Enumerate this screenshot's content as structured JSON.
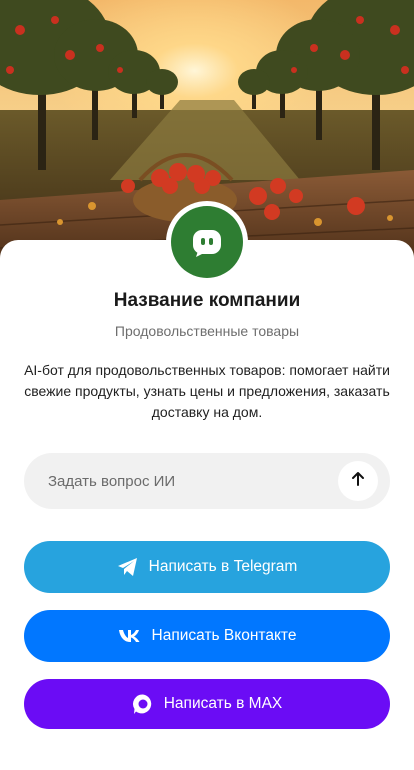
{
  "company": {
    "name": "Название компании",
    "category": "Продовольственные товары",
    "description": "AI-бот для продовольственных товаров: помогает найти свежие продукты, узнать цены и предложения, заказать доставку на дом.",
    "avatar_icon": "chat-bot-icon",
    "avatar_color": "#2e7d32"
  },
  "hero": {
    "image": "apple-orchard-photo",
    "description_icons": [
      "apple-basket",
      "orchard-trees",
      "sunset"
    ]
  },
  "ask": {
    "placeholder": "Задать вопрос ИИ",
    "send_icon": "arrow-up-icon"
  },
  "buttons": {
    "telegram": {
      "label": "Написать в Telegram",
      "icon": "telegram-icon",
      "color": "#27a3de"
    },
    "vk": {
      "label": "Написать Вконтакте",
      "icon": "vk-icon",
      "color": "#0177ff"
    },
    "max": {
      "label": "Написать в MAX",
      "icon": "max-icon",
      "color": "#6b0cf5"
    }
  }
}
